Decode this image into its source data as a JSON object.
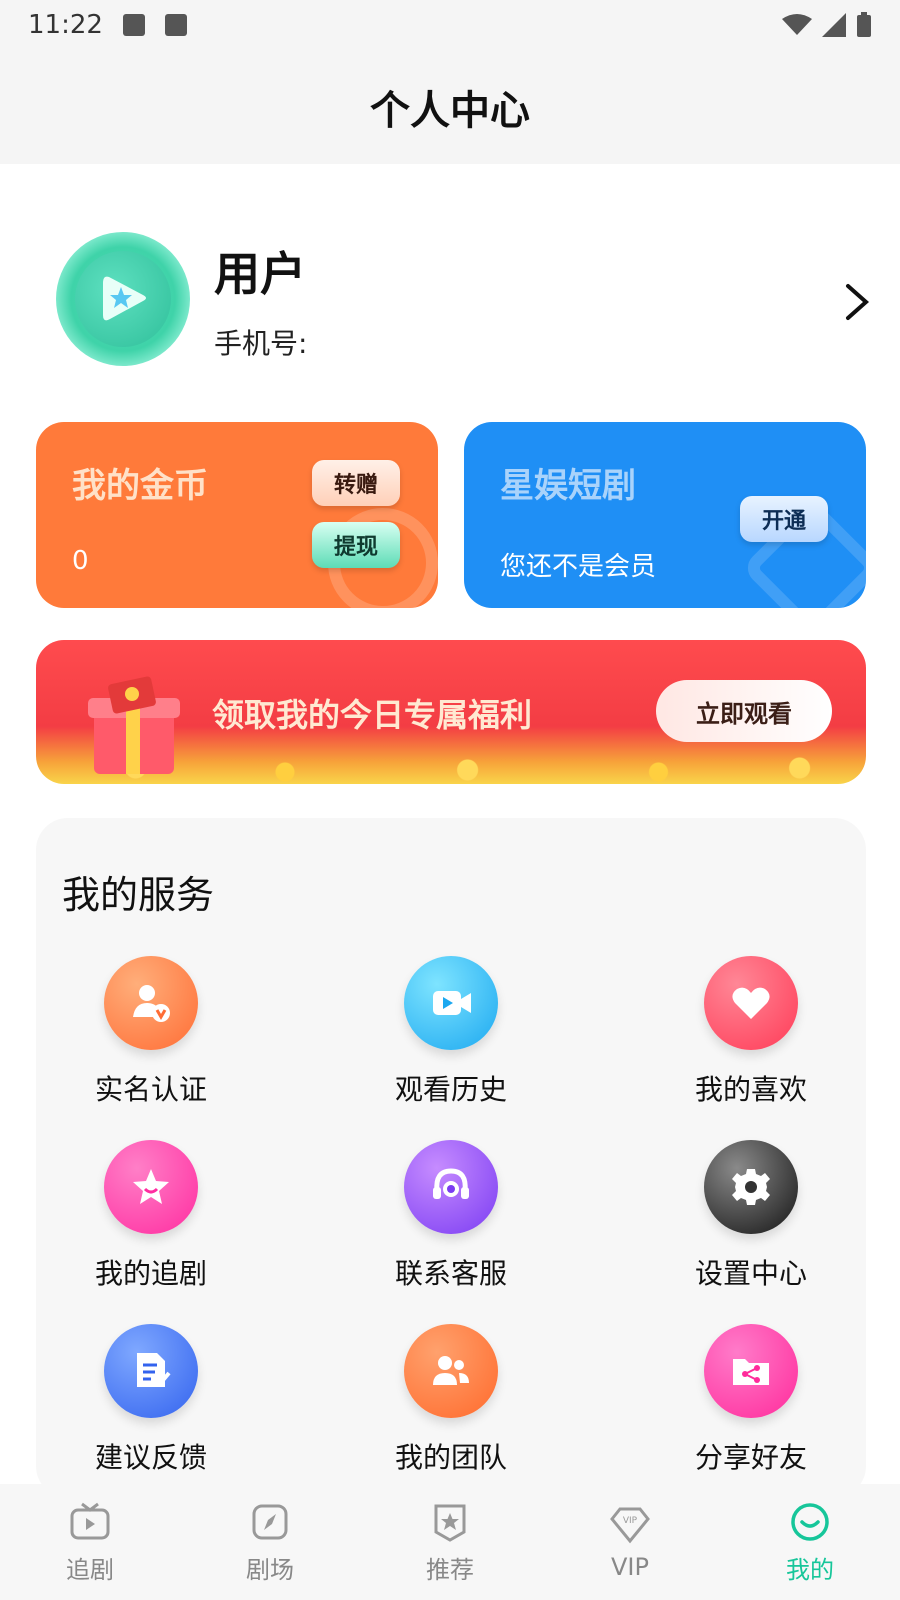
{
  "status_bar": {
    "time": "11:22"
  },
  "header": {
    "title": "个人中心"
  },
  "profile": {
    "name": "用户",
    "phone_label": "手机号:"
  },
  "coins_card": {
    "title": "我的金币",
    "value": "0",
    "transfer_label": "转赠",
    "withdraw_label": "提现"
  },
  "vip_card": {
    "title": "星娱短剧",
    "subtitle": "您还不是会员",
    "open_label": "开通"
  },
  "banner": {
    "text": "领取我的今日专属福利",
    "button_label": "立即观看"
  },
  "services": {
    "title": "我的服务",
    "items": [
      {
        "label": "实名认证",
        "icon": "verified-user-icon"
      },
      {
        "label": "观看历史",
        "icon": "video-camera-icon"
      },
      {
        "label": "我的喜欢",
        "icon": "heart-icon"
      },
      {
        "label": "我的追剧",
        "icon": "star-icon"
      },
      {
        "label": "联系客服",
        "icon": "headset-icon"
      },
      {
        "label": "设置中心",
        "icon": "gear-icon"
      },
      {
        "label": "建议反馈",
        "icon": "document-edit-icon"
      },
      {
        "label": "我的团队",
        "icon": "group-icon"
      },
      {
        "label": "分享好友",
        "icon": "share-folder-icon"
      }
    ]
  },
  "bottom_nav": {
    "items": [
      {
        "label": "追剧",
        "icon": "tv-icon"
      },
      {
        "label": "剧场",
        "icon": "compass-icon"
      },
      {
        "label": "推荐",
        "icon": "badge-star-icon"
      },
      {
        "label": "VIP",
        "icon": "vip-diamond-icon"
      },
      {
        "label": "我的",
        "icon": "smile-icon"
      }
    ],
    "active": "我的",
    "active_color": "#17c69a"
  },
  "colors": {
    "coins_card": "#ff7a3a",
    "vip_card": "#1f8ff5",
    "banner": "#f33d44",
    "accent": "#17c69a"
  }
}
